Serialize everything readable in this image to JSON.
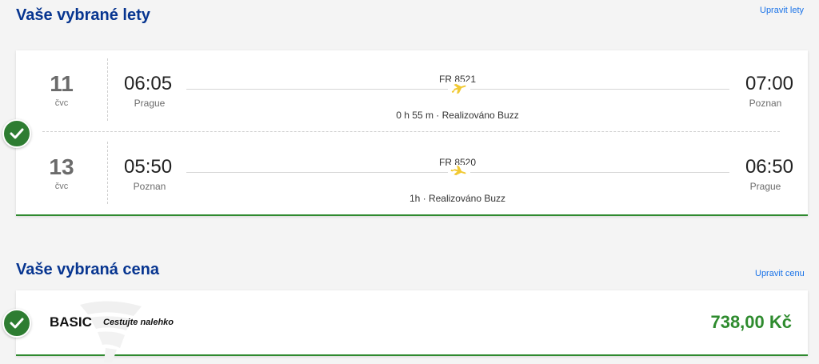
{
  "flights_section": {
    "title": "Vaše vybrané lety",
    "edit_label": "Upravit lety"
  },
  "flights": [
    {
      "day": "11",
      "month": "čvc",
      "departure_time": "06:05",
      "departure_city": "Prague",
      "flight_number": "FR 8521",
      "duration_operator": "0 h 55 m · Realizováno Buzz",
      "arrival_time": "07:00",
      "arrival_city": "Poznan"
    },
    {
      "day": "13",
      "month": "čvc",
      "departure_time": "05:50",
      "departure_city": "Poznan",
      "flight_number": "FR 8520",
      "duration_operator": "1h · Realizováno Buzz",
      "arrival_time": "06:50",
      "arrival_city": "Prague"
    }
  ],
  "fare_section": {
    "title": "Vaše vybraná cena",
    "edit_label": "Upravit cenu",
    "fare_name": "BASIC",
    "fare_tagline": "Cestujte nalehko",
    "price": "738,00 Kč"
  },
  "icons": {
    "check": "check-circle-icon",
    "plane": "plane-icon",
    "watermark": "ryanair-harp-logo"
  },
  "colors": {
    "title": "#073590",
    "link": "#1a73e8",
    "check": "#2e7d32",
    "price": "#2e8b2e",
    "plane": "#f1c933"
  }
}
